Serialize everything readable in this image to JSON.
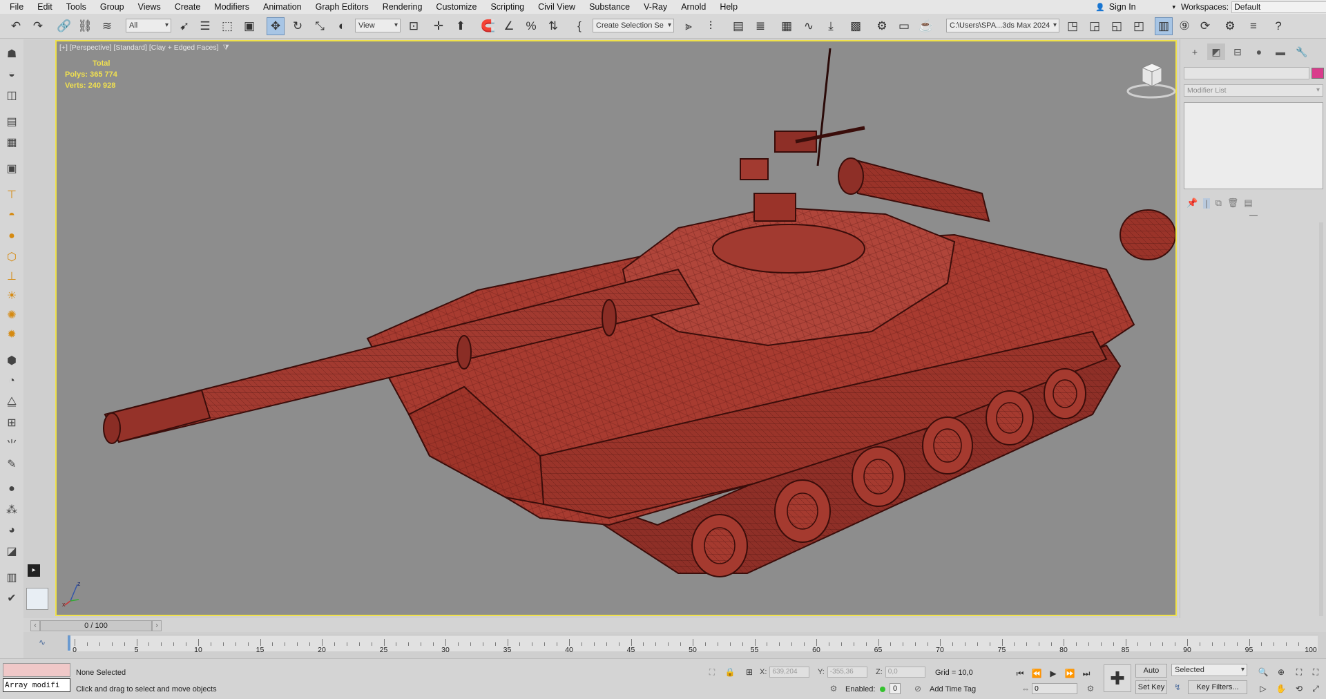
{
  "menu": [
    "File",
    "Edit",
    "Tools",
    "Group",
    "Views",
    "Create",
    "Modifiers",
    "Animation",
    "Graph Editors",
    "Rendering",
    "Customize",
    "Scripting",
    "Civil View",
    "Substance",
    "V-Ray",
    "Arnold",
    "Help"
  ],
  "account": {
    "sign_in": "Sign In",
    "workspaces_label": "Workspaces:",
    "workspace": "Default"
  },
  "toolbar": {
    "selection_filter": "All",
    "reference_coord": "View",
    "named_selection": "Create Selection Se",
    "project_path": "C:\\Users\\SPA...3ds Max 2024"
  },
  "viewport": {
    "label": "[+] [Perspective] [Standard] [Clay + Edged Faces]",
    "stats": {
      "header": "Total",
      "polys_label": "Polys:",
      "polys": "365 774",
      "verts_label": "Verts:",
      "verts": "240 928"
    },
    "axis_x": "x",
    "axis_z": "z",
    "tank_color": "#a83b30"
  },
  "command_panel": {
    "modifier_list": "Modifier List",
    "object_color": "#d93c8c"
  },
  "timeline": {
    "frame_display": "0 / 100",
    "ticks": [
      "0",
      "5",
      "10",
      "15",
      "20",
      "25",
      "30",
      "35",
      "40",
      "45",
      "50",
      "55",
      "60",
      "65",
      "70",
      "75",
      "80",
      "85",
      "90",
      "95",
      "100"
    ]
  },
  "status": {
    "script_text": "Array modifi",
    "selection": "None Selected",
    "prompt": "Click and drag to select and move objects",
    "x_label": "X:",
    "x_value": "639,204",
    "y_label": "Y:",
    "y_value": "-355,36",
    "z_label": "Z:",
    "z_value": "0,0",
    "grid": "Grid = 10,0",
    "enabled_label": "Enabled:",
    "enabled_value": "0",
    "add_time_tag": "Add Time Tag",
    "auto_key": "Auto Key",
    "set_key": "Set Key",
    "key_mode": "Selected",
    "key_filters": "Key Filters...",
    "current_frame": "0"
  }
}
